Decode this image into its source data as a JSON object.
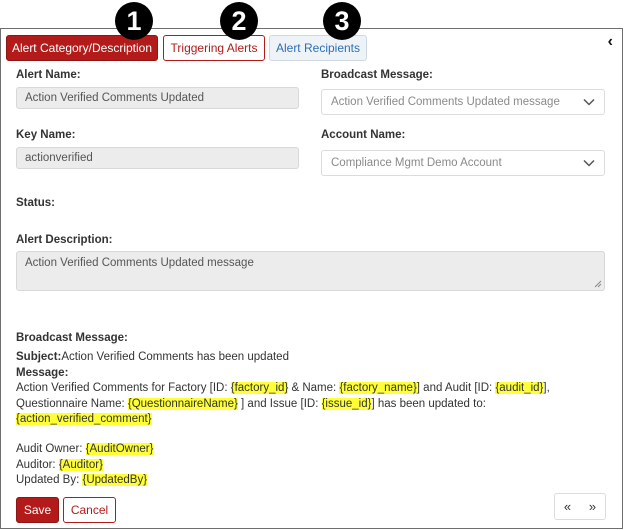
{
  "steps": [
    "1",
    "2",
    "3"
  ],
  "tabs": [
    {
      "label": "Alert Category/Description"
    },
    {
      "label": "Triggering Alerts"
    },
    {
      "label": "Alert Recipients"
    }
  ],
  "collapse_glyph": "‹",
  "form": {
    "alert_name_label": "Alert Name:",
    "alert_name_value": "Action Verified Comments Updated",
    "broadcast_label": "Broadcast Message:",
    "broadcast_value": "Action Verified Comments Updated message",
    "key_name_label": "Key Name:",
    "key_name_value": "actionverified",
    "account_label": "Account Name:",
    "account_value": "Compliance Mgmt Demo Account",
    "status_label": "Status:",
    "description_label": "Alert Description:",
    "description_value": "Action Verified Comments Updated message"
  },
  "broadcast_section": {
    "heading": "Broadcast Message:",
    "subject_label": "Subject:",
    "subject_text": "Action Verified Comments has been updated",
    "message_label": "Message:",
    "t1": "Action Verified Comments for Factory [ID: ",
    "v_factory_id": "{factory_id}",
    "t2": " & Name: ",
    "v_factory_name": "{factory_name}",
    "t3": "] and Audit [ID: ",
    "v_audit_id": "{audit_id}",
    "t4": "],",
    "t5": "Questionnaire Name: ",
    "v_questionnaire": "{QuestionnaireName}",
    "t6": " ] and Issue [ID: ",
    "v_issue_id": "{issue_id}",
    "t7": "] has been updated to:",
    "v_comment": "{action_verified_comment}",
    "owner_label": "Audit Owner: ",
    "v_owner": "{AuditOwner}",
    "auditor_label": "Auditor: ",
    "v_auditor": "{Auditor}",
    "updated_label": "Updated By: ",
    "v_updated": "{UpdatedBy}"
  },
  "buttons": {
    "save": "Save",
    "cancel": "Cancel"
  },
  "pager": {
    "prev": "«",
    "next": "»"
  },
  "colors": {
    "brand_red": "#b31b1b",
    "link_blue": "#2e6fb4",
    "highlight": "#ffff38"
  }
}
